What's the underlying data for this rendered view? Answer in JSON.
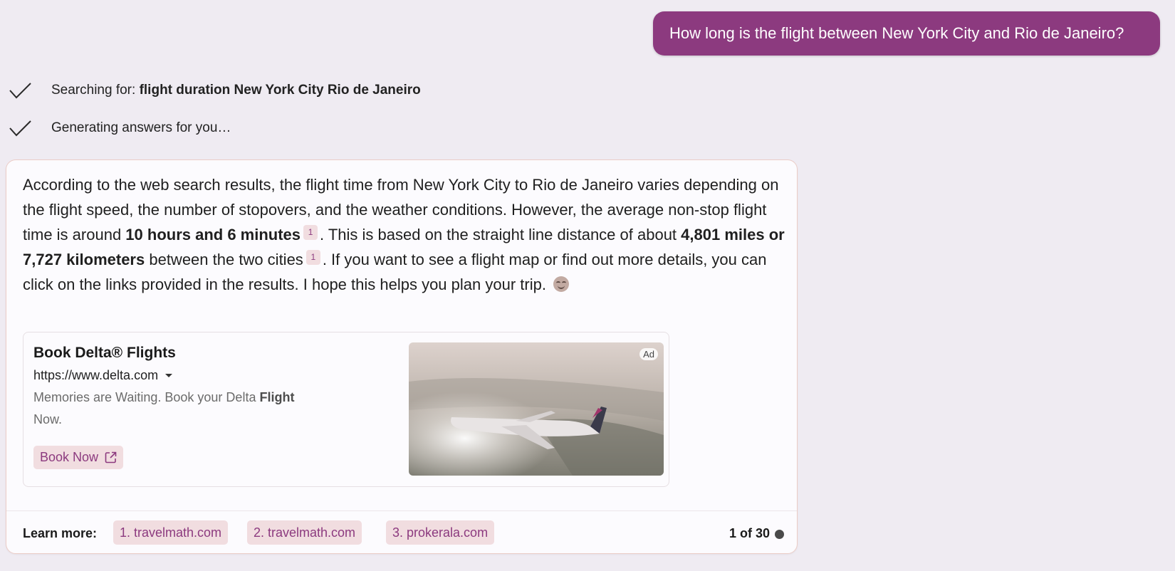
{
  "user_message": "How long is the flight between New York City and Rio de Janeiro?",
  "status": {
    "searching_label": "Searching for:",
    "search_query": "flight duration New York City Rio de Janeiro",
    "generating_label": "Generating answers for you…"
  },
  "answer": {
    "p1": "According to the web search results, the flight time from New York City to Rio de Janeiro varies depending on the flight speed, the number of stopovers, and the weather conditions. However, the average non-stop flight time is around ",
    "b1": "10 hours and 6 minutes",
    "cite1": "1",
    "p2": ". This is based on the straight line distance of about ",
    "b2": "4,801 miles or 7,727 kilometers",
    "p3": " between the two cities",
    "cite2": "1",
    "p4": ". If you want to see a flight map or find out more details, you can click on the links provided in the results. I hope this helps you plan your trip. ",
    "emoji": "smiling-face-emoji"
  },
  "ad": {
    "title": "Book Delta® Flights",
    "url": "https://www.delta.com",
    "desc_prefix": "Memories are Waiting. Book your Delta ",
    "desc_bold": "Flight",
    "desc_suffix": " Now.",
    "button_label": "Book Now",
    "badge": "Ad",
    "image": "airplane-over-ocean"
  },
  "learn_more": {
    "label": "Learn more:",
    "links": [
      "1. travelmath.com",
      "2. travelmath.com",
      "3. prokerala.com"
    ],
    "page_indicator": "1 of 30"
  },
  "colors": {
    "accent": "#8c3a7f",
    "chip_bg": "#f1dde0",
    "background": "#efebf2"
  }
}
